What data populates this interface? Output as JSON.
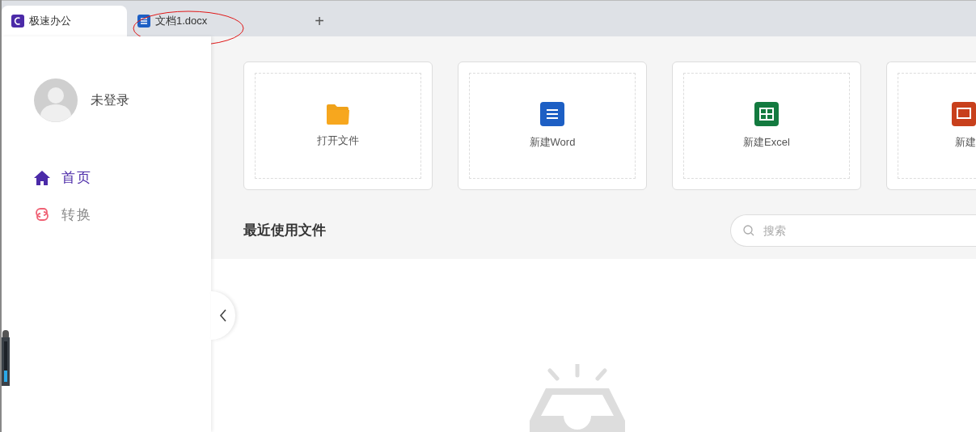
{
  "tabs": [
    {
      "label": "极速办公",
      "selected": true,
      "kind": "app"
    },
    {
      "label": "文档1.docx",
      "selected": false,
      "kind": "word"
    }
  ],
  "new_tab": "+",
  "user": {
    "name": "未登录"
  },
  "nav": [
    {
      "label": "首页",
      "selected": true,
      "kind": "home"
    },
    {
      "label": "转换",
      "selected": false,
      "kind": "convert"
    }
  ],
  "actions": [
    {
      "label": "打开文件",
      "kind": "folder"
    },
    {
      "label": "新建Word",
      "kind": "word"
    },
    {
      "label": "新建Excel",
      "kind": "excel"
    },
    {
      "label": "新建",
      "kind": "ppt"
    }
  ],
  "recent": {
    "title": "最近使用文件",
    "search": {
      "placeholder": "搜索"
    }
  }
}
